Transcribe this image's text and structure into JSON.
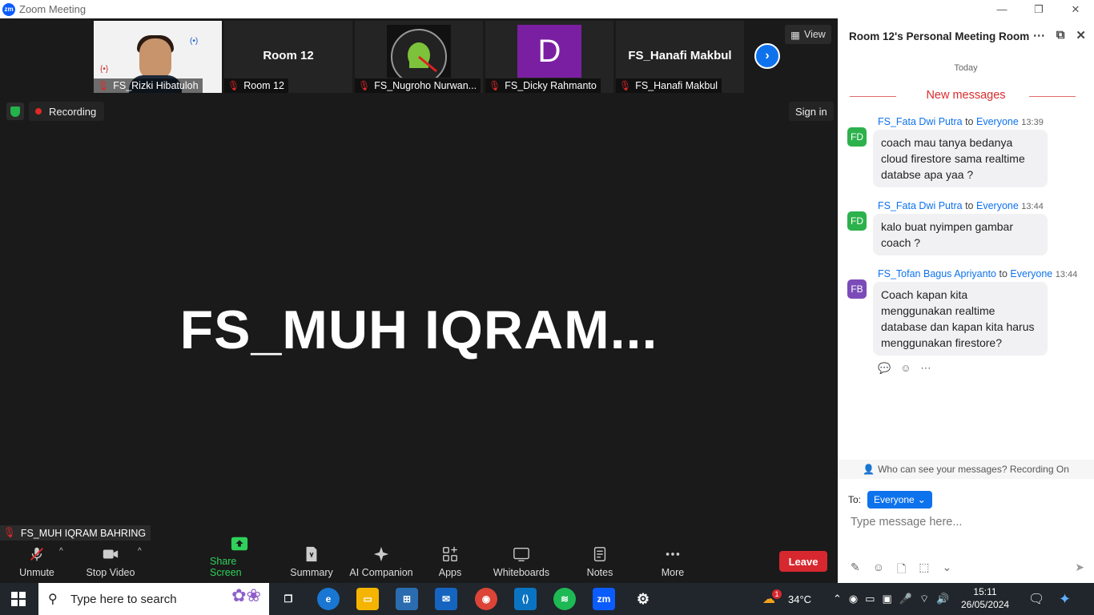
{
  "window": {
    "title": "Zoom Meeting",
    "logo": "zm"
  },
  "thumbnails": [
    {
      "name": "FS_Rizki Hibatuloh",
      "type": "photo"
    },
    {
      "name": "Room 12",
      "big_name": "Room 12",
      "type": "text"
    },
    {
      "name": "FS_Nugroho Nurwan...",
      "type": "android"
    },
    {
      "name": "FS_Dicky Rahmanto",
      "type": "letter",
      "letter": "D"
    },
    {
      "name": "FS_Hanafi Makbul",
      "big_name": "FS_Hanafi Makbul",
      "type": "text"
    }
  ],
  "view_button": "View",
  "recording_label": "Recording",
  "sign_in": "Sign in",
  "active_speaker": "FS_MUH  IQRAM...",
  "self_label": "FS_MUH IQRAM BAHRING",
  "toolbar": {
    "unmute": "Unmute",
    "stop_video": "Stop Video",
    "share_screen": "Share Screen",
    "summary": "Summary",
    "ai_companion": "AI Companion",
    "apps": "Apps",
    "whiteboards": "Whiteboards",
    "notes": "Notes",
    "more": "More",
    "leave": "Leave"
  },
  "chat": {
    "title": "Room 12's Personal Meeting Room",
    "today": "Today",
    "new_messages": "New messages",
    "to_word": "to",
    "messages": [
      {
        "initials": "FD",
        "avatar_color": "#2db14c",
        "sender": "FS_Fata Dwi Putra",
        "recipient": "Everyone",
        "time": "13:39",
        "text": "coach mau tanya bedanya cloud firestore sama realtime databse apa yaa ?"
      },
      {
        "initials": "FD",
        "avatar_color": "#2db14c",
        "sender": "FS_Fata Dwi Putra",
        "recipient": "Everyone",
        "time": "13:44",
        "text": "kalo buat nyimpen gambar coach ?"
      },
      {
        "initials": "FB",
        "avatar_color": "#7b4bb7",
        "sender": "FS_Tofan Bagus Apriyanto",
        "recipient": "Everyone",
        "time": "13:44",
        "text": "Coach kapan kita menggunakan realtime database dan kapan kita harus menggunakan firestore?"
      }
    ],
    "visibility_note": "Who can see your messages? Recording On",
    "to_label": "To:",
    "to_value": "Everyone",
    "input_placeholder": "Type message here..."
  },
  "taskbar": {
    "search_placeholder": "Type here to search",
    "weather": "34°C",
    "time": "15:11",
    "date": "26/05/2024",
    "notification_badge": "1"
  }
}
